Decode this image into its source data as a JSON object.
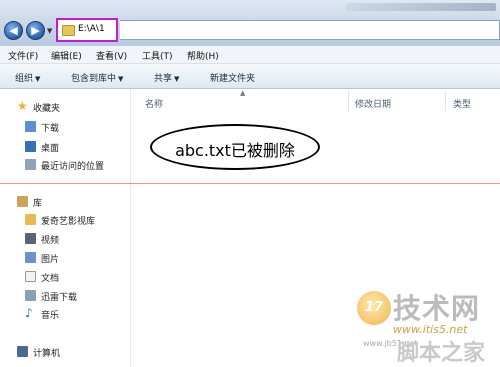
{
  "address": {
    "path": "E:\\A\\1"
  },
  "menu": [
    "文件(F)",
    "编辑(E)",
    "查看(V)",
    "工具(T)",
    "帮助(H)"
  ],
  "toolbar": {
    "organize": "组织",
    "include": "包含到库中",
    "share": "共享",
    "new_folder": "新建文件夹"
  },
  "nav": {
    "favorites": "收藏夹",
    "downloads": "下载",
    "desktop": "桌面",
    "recent": "最近访问的位置",
    "library": "库",
    "iqiyi": "爱奇艺影视库",
    "videos": "视频",
    "pictures": "图片",
    "documents": "文档",
    "xunlei": "迅雷下载",
    "music": "音乐",
    "computer": "计算机"
  },
  "columns": {
    "name": "名称",
    "modified": "修改日期",
    "type": "类型"
  },
  "annotation": "abc.txt已被删除",
  "watermark": {
    "logo": "17",
    "brand": "技术网",
    "url": "www.itis5.net",
    "brand2": "脚本之家",
    "url2": "www.jb51.net"
  },
  "colors": {
    "address_highlight": "#c21dc8",
    "divider": "#ff8a8a"
  }
}
